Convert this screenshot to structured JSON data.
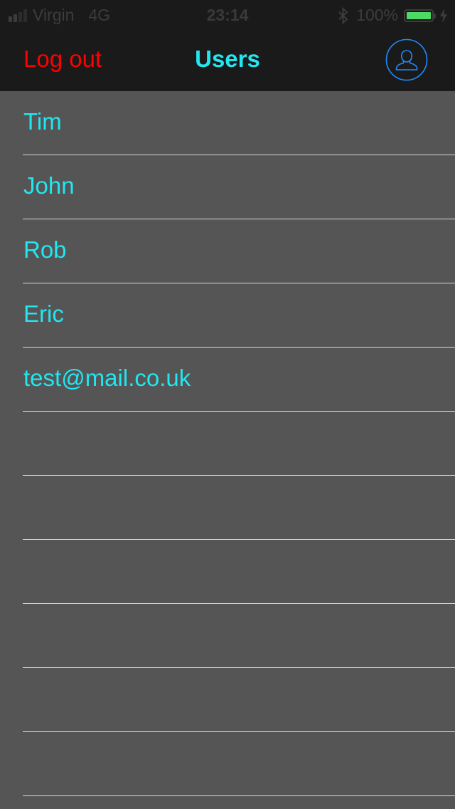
{
  "status_bar": {
    "carrier": "Virgin",
    "network": "4G",
    "time": "23:14",
    "battery_percent": "100%",
    "battery_level": 1.0,
    "signal_bars_filled": 2,
    "signal_bars_total": 4
  },
  "nav": {
    "logout_label": "Log out",
    "title": "Users",
    "profile_icon": "user-circle-icon"
  },
  "users": [
    {
      "name": "Tim"
    },
    {
      "name": "John"
    },
    {
      "name": "Rob"
    },
    {
      "name": "Eric"
    },
    {
      "name": "test@mail.co.uk"
    },
    {
      "name": ""
    },
    {
      "name": ""
    },
    {
      "name": ""
    },
    {
      "name": ""
    },
    {
      "name": ""
    },
    {
      "name": ""
    }
  ],
  "colors": {
    "logout": "#ff0000",
    "accent": "#22e6f0",
    "profile_icon": "#1f8bff",
    "list_background": "#555555",
    "bar_background": "#1a1a1a",
    "separator": "#d8d8d8",
    "battery": "#4cd964"
  }
}
